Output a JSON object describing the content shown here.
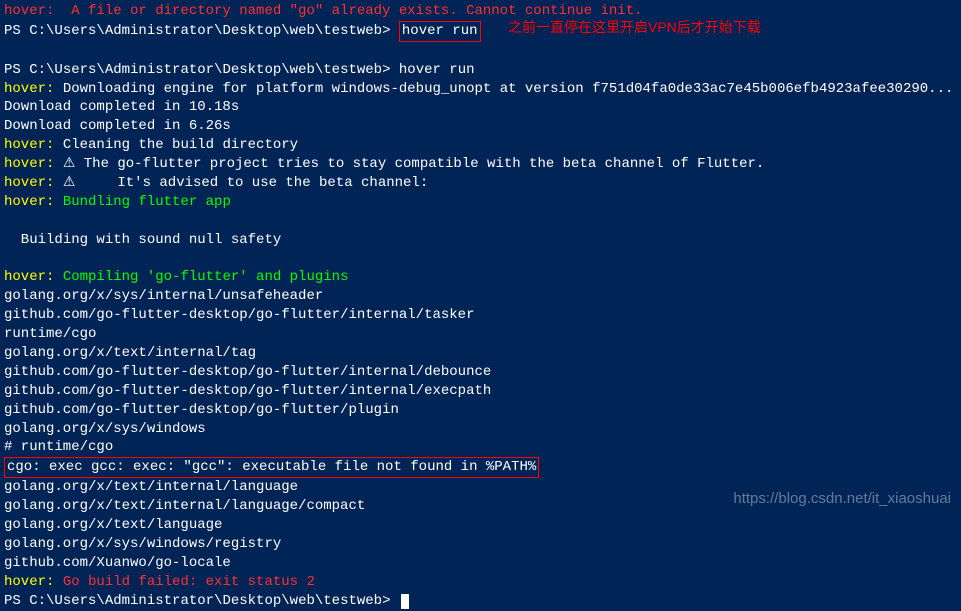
{
  "annotation": "之前一直停在这里开启VPN后才开始下载",
  "prompt_path": "C:\\Users\\Administrator\\Desktop\\web\\testweb",
  "ps_prefix": "PS ",
  "cmd1": "hover run",
  "cmd2": "hover run",
  "hover_label": "hover:",
  "line_top_red": "hover:  A file or directory named \"go\" already exists. Cannot continue init.",
  "download_engine": " Downloading engine for platform windows-debug_unopt at version f751d04fa0de33ac7e45b006efb4923afee30290...",
  "download1": "Download completed in 10.18s",
  "download2": "Download completed in 6.26s",
  "cleaning": " Cleaning the build directory",
  "warn1": " ⚠ The go-flutter project tries to stay compatible with the beta channel of Flutter.",
  "warn2": " ⚠     It's advised to use the beta channel:",
  "bundling": " Bundling flutter app",
  "building": " Building with sound null safety",
  "compiling": " Compiling 'go-flutter' and plugins",
  "pkg1": "golang.org/x/sys/internal/unsafeheader",
  "pkg2": "github.com/go-flutter-desktop/go-flutter/internal/tasker",
  "pkg3": "runtime/cgo",
  "pkg4": "golang.org/x/text/internal/tag",
  "pkg5": "github.com/go-flutter-desktop/go-flutter/internal/debounce",
  "pkg6": "github.com/go-flutter-desktop/go-flutter/internal/execpath",
  "pkg7": "github.com/go-flutter-desktop/go-flutter/plugin",
  "pkg8": "golang.org/x/sys/windows",
  "runtime_cgo": "# runtime/cgo",
  "cgo_error": "cgo: exec gcc: exec: \"gcc\": executable file not found in %PATH%",
  "pkg9": "golang.org/x/text/internal/language",
  "pkg10": "golang.org/x/text/internal/language/compact",
  "pkg11": "golang.org/x/text/language",
  "pkg12": "golang.org/x/sys/windows/registry",
  "pkg13": "github.com/Xuanwo/go-locale",
  "build_failed": " Go build failed: exit status 2",
  "watermark": "https://blog.csdn.net/it_xiaoshuai"
}
